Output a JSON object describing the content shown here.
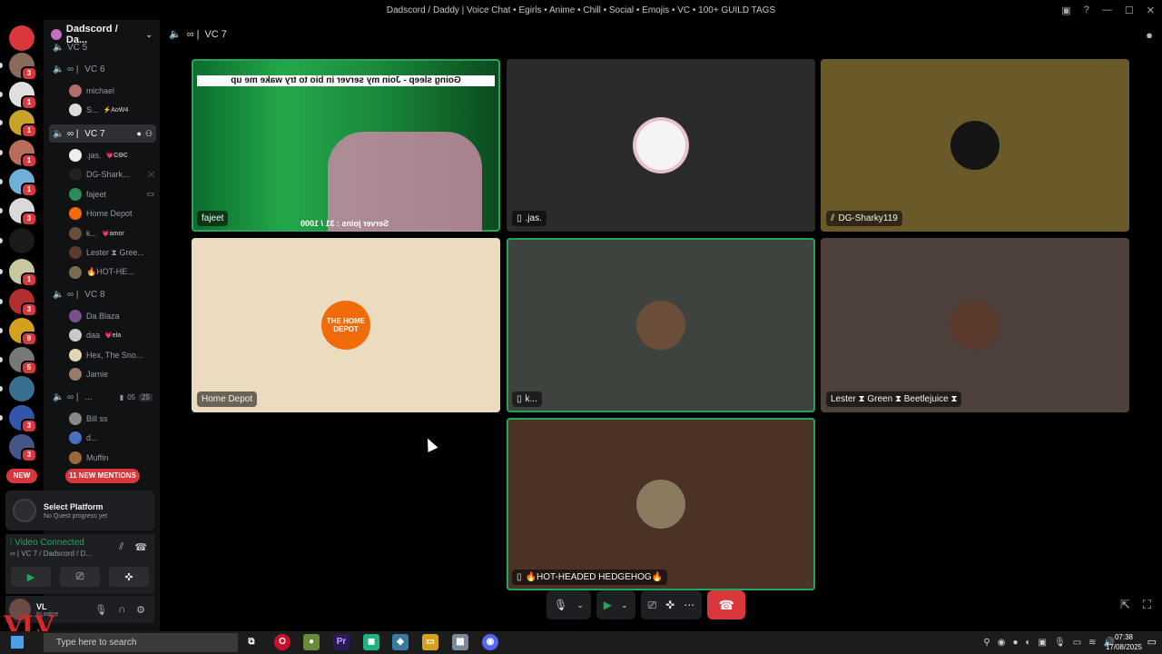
{
  "window": {
    "title": "Dadscord / Daddy | Voice Chat • Egirls • Anime • Chill • Social • Emojis • VC • 100+ GUILD TAGS"
  },
  "rail": {
    "servers": [
      {
        "name": "discord-home",
        "color": "#da373c",
        "badge": ""
      },
      {
        "name": "server-1",
        "color": "#8a6a5a",
        "badge": "3"
      },
      {
        "name": "server-2",
        "color": "#e0e0e0",
        "badge": "1"
      },
      {
        "name": "server-3",
        "color": "#c9a227",
        "badge": "1"
      },
      {
        "name": "server-4",
        "color": "#b86c5a",
        "badge": "1"
      },
      {
        "name": "server-5",
        "color": "#6fb0d8",
        "badge": "1"
      },
      {
        "name": "server-6",
        "color": "#d9d9d9",
        "badge": "3"
      },
      {
        "name": "server-7",
        "color": "#1a1a1a",
        "badge": ""
      },
      {
        "name": "server-8",
        "color": "#c8c8a0",
        "badge": "1"
      },
      {
        "name": "server-9",
        "color": "#b03030",
        "badge": "3"
      },
      {
        "name": "server-10",
        "color": "#d4a020",
        "badge": "9"
      },
      {
        "name": "server-11",
        "color": "#777777",
        "badge": "5"
      },
      {
        "name": "server-12",
        "color": "#3a6e8f",
        "badge": ""
      },
      {
        "name": "server-13",
        "color": "#3355aa",
        "badge": "3"
      },
      {
        "name": "server-14",
        "color": "#445588",
        "badge": "3"
      }
    ],
    "new_label": "NEW"
  },
  "sidebar": {
    "guild_name": "Dadscord / Da...",
    "channels": [
      {
        "label": "VC 5",
        "top": 0
      },
      {
        "label": "VC 6"
      },
      {
        "label": "VC 7"
      },
      {
        "label": "VC 8"
      },
      {
        "label": "..."
      }
    ],
    "vc6_users": [
      {
        "name": "michael",
        "tag": "",
        "color": "#b36b6b"
      },
      {
        "name": "S...",
        "tag": "⚡AoW4",
        "color": "#dcdcdc"
      }
    ],
    "vc7_users": [
      {
        "name": ".jas.",
        "tag": "💗ϾϴϾ",
        "color": "#eeeeee",
        "icon": ""
      },
      {
        "name": "DG-Shark...",
        "tag": "",
        "color": "#222222",
        "icon": "⤫"
      },
      {
        "name": "fajeet",
        "tag": "",
        "color": "#2e8b57",
        "icon": "▭"
      },
      {
        "name": "Home Depot",
        "tag": "",
        "color": "#f26b0b",
        "icon": ""
      },
      {
        "name": "k...",
        "tag": "💗amor",
        "color": "#6a4e3a",
        "icon": ""
      },
      {
        "name": "Lester ⧗ Gree...",
        "tag": "",
        "color": "#5a3b2e",
        "icon": ""
      },
      {
        "name": "🔥HOT-HE...",
        "tag": "",
        "color": "#7a6a50",
        "icon": ""
      }
    ],
    "vc8_users": [
      {
        "name": "Da Blaza",
        "color": "#7a4f8a"
      },
      {
        "name": "daa",
        "tag": "💗ela",
        "color": "#c9c9c9"
      },
      {
        "name": "Hex, The Sno...",
        "color": "#e0d6b0"
      },
      {
        "name": "Jamie",
        "color": "#9a7a6a"
      }
    ],
    "vc9_counts": {
      "a": "05",
      "b": "25"
    },
    "vc9_users": [
      {
        "name": "Bill ss",
        "color": "#888888"
      },
      {
        "name": "d...",
        "color": "#4a70c0"
      },
      {
        "name": "Muffin",
        "color": "#9a6a3a"
      }
    ],
    "mentions_label": "11 NEW MENTIONS"
  },
  "quest": {
    "title": "Select Platform",
    "subtitle": "No Quest progress yet"
  },
  "voice": {
    "status": "Video Connected",
    "location": "VC 7 / Dadscord / D..."
  },
  "user": {
    "name": "VL",
    "status": "In voice"
  },
  "stage": {
    "channel_name": "VC 7",
    "tiles": [
      {
        "label": "fajeet",
        "stream_text": "Going sleep - Join my server in bio to try wake me up",
        "stream_bottom": "Server joins : 31 / 1000"
      },
      {
        "label": ".jas."
      },
      {
        "label": "DG-Sharky119"
      },
      {
        "label": "Home Depot",
        "logo": "THE HOME DEPOT"
      },
      {
        "label": "k..."
      },
      {
        "label": "Lester ⧗ Green ⧗ Beetlejuice ⧗"
      },
      {
        "label": "🔥HOT-HEADED HEDGEHOG🔥"
      }
    ]
  },
  "taskbar": {
    "search_placeholder": "Type here to search",
    "time": "07:38",
    "date": "17/08/2025"
  }
}
